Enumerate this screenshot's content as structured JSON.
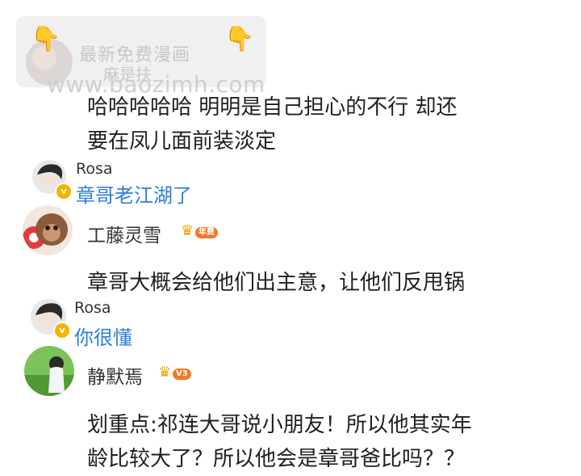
{
  "watermark": {
    "top_text": "最新免费漫画",
    "url": "www.baozimh.com",
    "name": "麻是扶"
  },
  "comments": [
    {
      "text": "哈哈哈哈哈 明明是自己担心的不行 却还\n要在凤儿面前装淡定"
    },
    {
      "reply_name": "Rosa",
      "reply_text": "章哥老江湖了"
    },
    {
      "user": "工藤灵雪",
      "badge": "年费"
    },
    {
      "text": "章哥大概会给他们出主意，让他们反甩锅"
    },
    {
      "reply_name": "Rosa",
      "reply_text": "你很懂"
    },
    {
      "user": "静默焉",
      "badge": "V3"
    },
    {
      "text": "划重点:祁连大哥说小朋友！所以他其实年\n龄比较大了？所以他会是章哥爸比吗？？"
    }
  ],
  "colors": {
    "reply_blue": "#2d7fd6",
    "crown_gold": "#f5a000",
    "level_orange": "#f07a2a"
  }
}
